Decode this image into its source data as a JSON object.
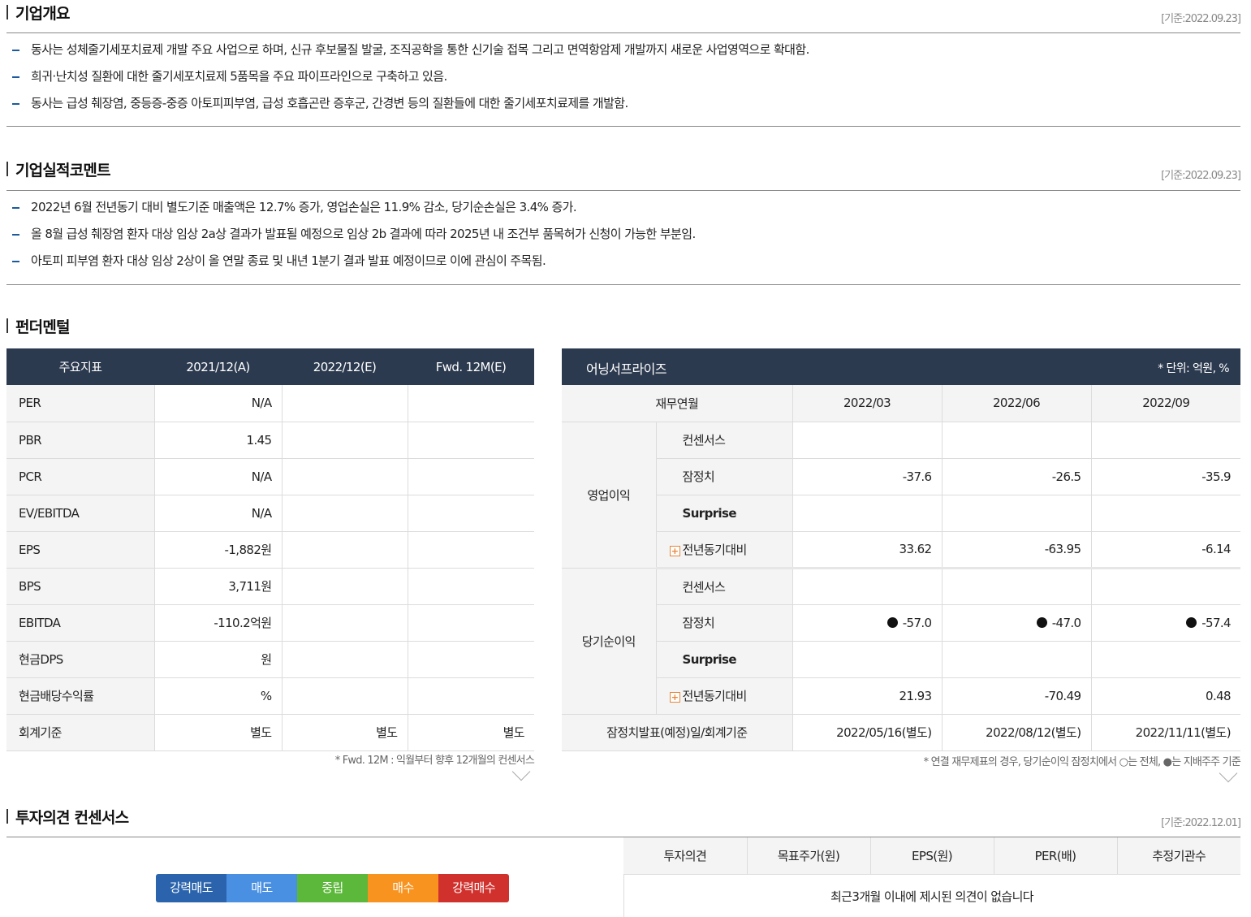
{
  "overview": {
    "title": "기업개요",
    "date": "[기준:2022.09.23]",
    "items": [
      "동사는 성체줄기세포치료제 개발 주요 사업으로 하며, 신규 후보물질 발굴, 조직공학을 통한 신기술 접목 그리고 면역항암제 개발까지 새로운 사업영역으로 확대함.",
      "희귀·난치성 질환에 대한 줄기세포치료제 5품목을 주요 파이프라인으로 구축하고 있음.",
      "동사는 급성 췌장염, 중등증-중증 아토피피부염, 급성 호흡곤란 증후군, 간경변 등의 질환들에 대한 줄기세포치료제를 개발함."
    ]
  },
  "comment": {
    "title": "기업실적코멘트",
    "date": "[기준:2022.09.23]",
    "items": [
      "2022년 6월 전년동기 대비 별도기준 매출액은 12.7% 증가, 영업손실은 11.9% 감소, 당기순손실은 3.4% 증가.",
      "올 8월 급성 췌장염 환자 대상 임상 2a상 결과가 발표될 예정으로 임상 2b 결과에 따라 2025년 내 조건부 품목허가 신청이 가능한 부분임.",
      "아토피 피부염 환자 대상 임상 2상이 올 연말 종료 및 내년 1분기 결과 발표 예정이므로 이에 관심이 주목됨."
    ]
  },
  "fundamental": {
    "title": "펀더멘털",
    "headers": [
      "주요지표",
      "2021/12(A)",
      "2022/12(E)",
      "Fwd. 12M(E)"
    ],
    "rows": [
      {
        "label": "PER",
        "v1": "N/A",
        "v2": "",
        "v3": ""
      },
      {
        "label": "PBR",
        "v1": "1.45",
        "v2": "",
        "v3": ""
      },
      {
        "label": "PCR",
        "v1": "N/A",
        "v2": "",
        "v3": ""
      },
      {
        "label": "EV/EBITDA",
        "v1": "N/A",
        "v2": "",
        "v3": ""
      },
      {
        "label": "EPS",
        "v1": "-1,882원",
        "v2": "",
        "v3": ""
      },
      {
        "label": "BPS",
        "v1": "3,711원",
        "v2": "",
        "v3": ""
      },
      {
        "label": "EBITDA",
        "v1": "-110.2억원",
        "v2": "",
        "v3": ""
      },
      {
        "label": "현금DPS",
        "v1": "원",
        "v2": "",
        "v3": ""
      },
      {
        "label": "현금배당수익률",
        "v1": "%",
        "v2": "",
        "v3": ""
      },
      {
        "label": "회계기준",
        "v1": "별도",
        "v2": "별도",
        "v3": "별도"
      }
    ],
    "note": "* Fwd. 12M : 익월부터 향후 12개월의 컨센서스"
  },
  "earnings": {
    "title": "어닝서프라이즈",
    "unit": "* 단위: 억원, %",
    "col_label": "재무연월",
    "periods": [
      "2022/03",
      "2022/06",
      "2022/09"
    ],
    "op": {
      "group": "영업이익",
      "consensus_label": "컨센서스",
      "consensus": [
        "",
        "",
        ""
      ],
      "prelim_label": "잠정치",
      "prelim": [
        "-37.6",
        "-26.5",
        "-35.9"
      ],
      "surprise_label": "Surprise",
      "surprise": [
        "",
        "",
        ""
      ],
      "yoy_label": "전년동기대비",
      "yoy": [
        "33.62",
        "-63.95",
        "-6.14"
      ]
    },
    "net": {
      "group": "당기순이익",
      "consensus_label": "컨센서스",
      "consensus": [
        "",
        "",
        ""
      ],
      "prelim_label": "잠정치",
      "prelim": [
        "-57.0",
        "-47.0",
        "-57.4"
      ],
      "surprise_label": "Surprise",
      "surprise": [
        "",
        "",
        ""
      ],
      "yoy_label": "전년동기대비",
      "yoy": [
        "21.93",
        "-70.49",
        "0.48"
      ]
    },
    "release_label": "잠정치발표(예정)일/회계기준",
    "release": [
      "2022/05/16(별도)",
      "2022/08/12(별도)",
      "2022/11/11(별도)"
    ],
    "note": "* 연결 재무제표의 경우, 당기순이익 잠정치에서 ○는 전체, ●는 지배주주 기준"
  },
  "opinion": {
    "title": "투자의견 컨센서스",
    "date": "[기준:2022.12.01]",
    "gauge": [
      {
        "label": "강력매도",
        "color": "#2b64ad"
      },
      {
        "label": "매도",
        "color": "#4a90e2"
      },
      {
        "label": "중립",
        "color": "#5cb83a"
      },
      {
        "label": "매수",
        "color": "#f7931e"
      },
      {
        "label": "강력매수",
        "color": "#d0312d"
      }
    ],
    "headers": [
      "투자의견",
      "목표주가(원)",
      "EPS(원)",
      "PER(배)",
      "추정기관수"
    ],
    "empty_text": "최근3개월 이내에 제시된 의견이 없습니다"
  }
}
